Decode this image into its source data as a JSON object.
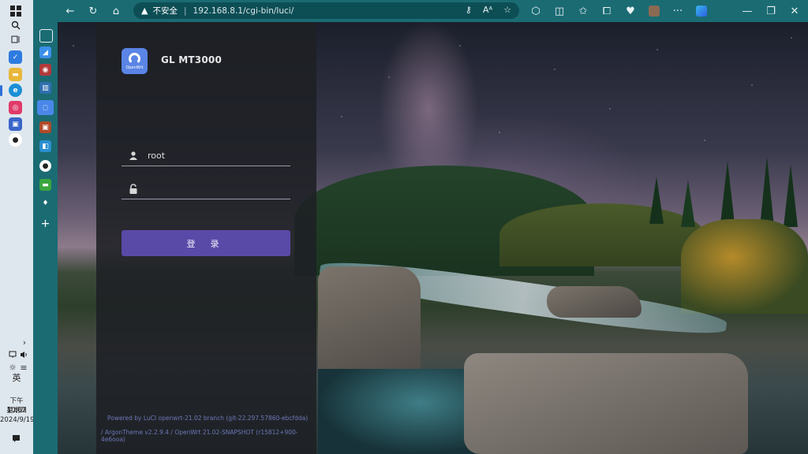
{
  "browser": {
    "security_label": "不安全",
    "url": "192.168.8.1/cgi-bin/luci/"
  },
  "taskbar": {
    "chevron": "›",
    "time_prefix": "下午",
    "time": "10:02",
    "weekday": "星期四",
    "date": "2024/9/19",
    "ime": "英"
  },
  "login": {
    "brand": "GL MT3000",
    "logo_text": "OpenWrt",
    "username_value": "root",
    "password_value": "",
    "submit_label": "登 录"
  },
  "footer": {
    "line1": "Powered by LuCI openwrt-21.02 branch (git-22.297.57860-ebcfdda)",
    "line2": "/ ArgonTheme v2.2.9.4 / OpenWrt 21.02-SNAPSHOT (r15812+900-4e6ooa)"
  }
}
